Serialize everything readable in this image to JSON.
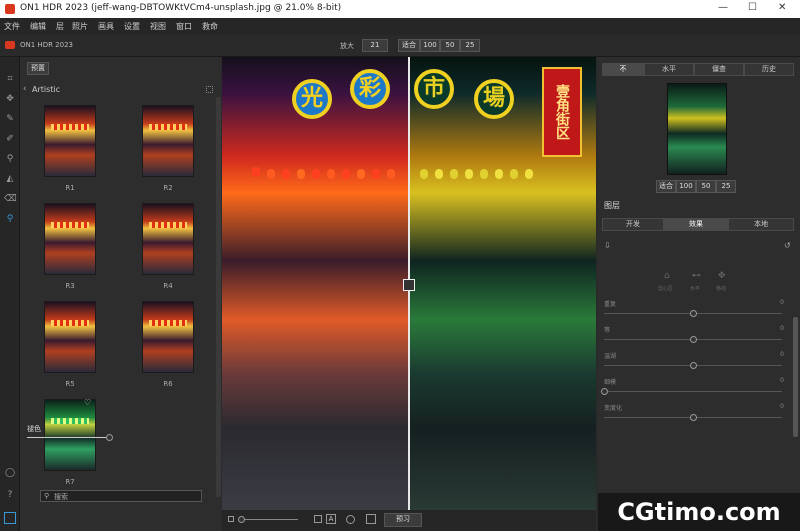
{
  "window": {
    "title": "ON1 HDR 2023 (jeff-wang-DBTOWKtVCm4-unsplash.jpg @ 21.0% 8-bit)",
    "min": "—",
    "max": "☐",
    "close": "✕"
  },
  "menu": [
    "文件",
    "编辑",
    "层",
    "照片",
    "画具",
    "设置",
    "视图",
    "窗口",
    "救命"
  ],
  "toolbar": {
    "app_name": "ON1 HDR 2023",
    "zoom_label": "放大",
    "zoom_value": "21",
    "fit": "适合",
    "z100": "100",
    "z50": "50",
    "z25": "25"
  },
  "left_panel": {
    "preset_button": "预置",
    "category": "Artistic",
    "thumbs": [
      "R1",
      "R2",
      "R3",
      "R4",
      "R5",
      "R6",
      "R7"
    ],
    "blend_label": "褪色",
    "search_placeholder": "搜索"
  },
  "image": {
    "signs": [
      "光",
      "彩",
      "市",
      "場"
    ],
    "vertical_sign": "壹角街区"
  },
  "bottom": {
    "preview_button": "预习"
  },
  "right_panel": {
    "tabs_top": [
      "不",
      "水平",
      "僵查",
      "历史"
    ],
    "nav_fit": "适合",
    "nav_100": "100",
    "nav_50": "50",
    "nav_25": "25",
    "layers_title": "图层",
    "tabs_layers": [
      "开发",
      "效果",
      "本地"
    ],
    "transform_icons": [
      "剪心区",
      "水平",
      "移动"
    ],
    "sliders": [
      {
        "label": "重复",
        "value": "0",
        "pos": 0.5
      },
      {
        "label": "等",
        "value": "0",
        "pos": 0.5
      },
      {
        "label": "温湖",
        "value": "0",
        "pos": 0.5
      },
      {
        "label": "细模",
        "value": "0",
        "pos": 0.0
      },
      {
        "label": "变度化",
        "value": "0",
        "pos": 0.5
      }
    ]
  },
  "watermark": "CGtimo.com",
  "colors": {
    "accent": "#3a9ad9",
    "sign_yellow": "#f0d020",
    "sign_red": "#c01818"
  }
}
